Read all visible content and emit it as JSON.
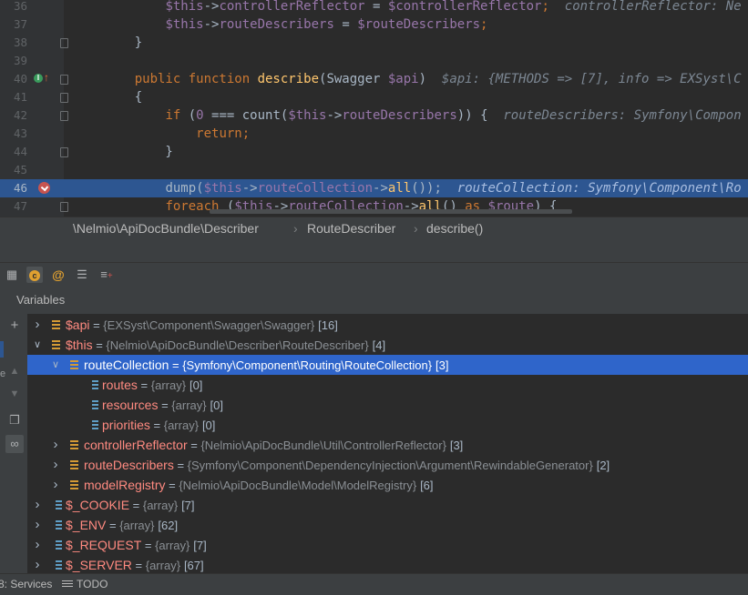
{
  "editor": {
    "lines": [
      {
        "num": "36",
        "segments": [
          {
            "t": "        ",
            "c": ""
          },
          {
            "t": "$this",
            "c": "vr"
          },
          {
            "t": "->",
            "c": ""
          },
          {
            "t": "controllerReflector",
            "c": "vr"
          },
          {
            "t": " = ",
            "c": ""
          },
          {
            "t": "$controllerReflector",
            "c": "vr"
          },
          {
            "t": ";",
            "c": "kw"
          },
          {
            "t": "  controllerReflector: Ne",
            "c": "hint"
          }
        ]
      },
      {
        "num": "37",
        "segments": [
          {
            "t": "        ",
            "c": ""
          },
          {
            "t": "$this",
            "c": "vr"
          },
          {
            "t": "->",
            "c": ""
          },
          {
            "t": "routeDescribers",
            "c": "vr"
          },
          {
            "t": " = ",
            "c": ""
          },
          {
            "t": "$routeDescribers",
            "c": "vr"
          },
          {
            "t": ";",
            "c": "kw"
          }
        ]
      },
      {
        "num": "38",
        "segments": [
          {
            "t": "    }",
            "c": ""
          }
        ]
      },
      {
        "num": "39",
        "segments": []
      },
      {
        "num": "40",
        "segments": [
          {
            "t": "    ",
            "c": ""
          },
          {
            "t": "public function ",
            "c": "kw"
          },
          {
            "t": "describe",
            "c": "fn"
          },
          {
            "t": "(Swagger ",
            "c": ""
          },
          {
            "t": "$api",
            "c": "vr"
          },
          {
            "t": ")",
            "c": ""
          },
          {
            "t": "  $api: {METHODS => [7], info => EXSyst\\C",
            "c": "hint"
          }
        ]
      },
      {
        "num": "41",
        "segments": [
          {
            "t": "    {",
            "c": ""
          }
        ]
      },
      {
        "num": "42",
        "segments": [
          {
            "t": "        ",
            "c": ""
          },
          {
            "t": "if ",
            "c": "kw"
          },
          {
            "t": "(",
            "c": ""
          },
          {
            "t": "0",
            "c": "vr"
          },
          {
            "t": " === count(",
            "c": ""
          },
          {
            "t": "$this",
            "c": "vr"
          },
          {
            "t": "->",
            "c": ""
          },
          {
            "t": "routeDescribers",
            "c": "vr"
          },
          {
            "t": ")) {",
            "c": ""
          },
          {
            "t": "  routeDescribers: Symfony\\Compon",
            "c": "hint"
          }
        ]
      },
      {
        "num": "43",
        "segments": [
          {
            "t": "            ",
            "c": ""
          },
          {
            "t": "return;",
            "c": "kw"
          }
        ]
      },
      {
        "num": "44",
        "segments": [
          {
            "t": "        }",
            "c": ""
          }
        ]
      },
      {
        "num": "45",
        "segments": []
      },
      {
        "num": "46",
        "segments": [
          {
            "t": "        ",
            "c": ""
          },
          {
            "t": "dump(",
            "c": ""
          },
          {
            "t": "$this",
            "c": "vr"
          },
          {
            "t": "->",
            "c": ""
          },
          {
            "t": "routeCollection",
            "c": "vr"
          },
          {
            "t": "->",
            "c": ""
          },
          {
            "t": "all",
            "c": "fn"
          },
          {
            "t": "());",
            "c": ""
          },
          {
            "t": "  routeCollection: Symfony\\Component\\Ro",
            "c": "hint"
          }
        ]
      },
      {
        "num": "47",
        "segments": [
          {
            "t": "        ",
            "c": ""
          },
          {
            "t": "foreach ",
            "c": "kw"
          },
          {
            "t": "(",
            "c": ""
          },
          {
            "t": "$this",
            "c": "vr"
          },
          {
            "t": "->",
            "c": ""
          },
          {
            "t": "routeCollection",
            "c": "vr"
          },
          {
            "t": "->",
            "c": ""
          },
          {
            "t": "all",
            "c": "fn"
          },
          {
            "t": "() ",
            "c": ""
          },
          {
            "t": "as ",
            "c": "kw"
          },
          {
            "t": "$route",
            "c": "vr"
          },
          {
            "t": ") {",
            "c": ""
          }
        ]
      }
    ]
  },
  "breadcrumb": {
    "namespace": "\\Nelmio\\ApiDocBundle\\Describer",
    "class": "RouteDescriber",
    "method": "describe()",
    "sep": "›"
  },
  "toolbar": {
    "icons": [
      "table-icon",
      "class-icon",
      "at-icon",
      "list-icon",
      "add-watch-icon"
    ]
  },
  "variables": {
    "title": "Variables",
    "rows": [
      {
        "depth": 0,
        "expanded": false,
        "icon": "field",
        "name": "$api",
        "value": "{EXSyst\\Component\\Swagger\\Swagger}",
        "count": "[16]"
      },
      {
        "depth": 0,
        "expanded": true,
        "icon": "field",
        "name": "$this",
        "value": "{Nelmio\\ApiDocBundle\\Describer\\RouteDescriber}",
        "count": "[4]"
      },
      {
        "depth": 1,
        "expanded": true,
        "icon": "field",
        "name": "routeCollection",
        "value": "{Symfony\\Component\\Routing\\RouteCollection}",
        "count": "[3]",
        "selected": true
      },
      {
        "depth": 2,
        "expanded": null,
        "icon": "array",
        "name": "routes",
        "value": "{array}",
        "count": "[0]"
      },
      {
        "depth": 2,
        "expanded": null,
        "icon": "array",
        "name": "resources",
        "value": "{array}",
        "count": "[0]"
      },
      {
        "depth": 2,
        "expanded": null,
        "icon": "array",
        "name": "priorities",
        "value": "{array}",
        "count": "[0]"
      },
      {
        "depth": 1,
        "expanded": false,
        "icon": "field",
        "name": "controllerReflector",
        "value": "{Nelmio\\ApiDocBundle\\Util\\ControllerReflector}",
        "count": "[3]"
      },
      {
        "depth": 1,
        "expanded": false,
        "icon": "field",
        "name": "routeDescribers",
        "value": "{Symfony\\Component\\DependencyInjection\\Argument\\RewindableGenerator}",
        "count": "[2]"
      },
      {
        "depth": 1,
        "expanded": false,
        "icon": "field",
        "name": "modelRegistry",
        "value": "{Nelmio\\ApiDocBundle\\Model\\ModelRegistry}",
        "count": "[6]"
      },
      {
        "depth": 0,
        "expanded": false,
        "icon": "array",
        "name": "$_COOKIE",
        "value": "{array}",
        "count": "[7]"
      },
      {
        "depth": 0,
        "expanded": false,
        "icon": "array",
        "name": "$_ENV",
        "value": "{array}",
        "count": "[62]"
      },
      {
        "depth": 0,
        "expanded": false,
        "icon": "array",
        "name": "$_REQUEST",
        "value": "{array}",
        "count": "[7]"
      },
      {
        "depth": 0,
        "expanded": false,
        "icon": "array",
        "name": "$_SERVER",
        "value": "{array}",
        "count": "[67]"
      }
    ]
  },
  "status": {
    "services": "8: Services",
    "todo": "TODO"
  }
}
